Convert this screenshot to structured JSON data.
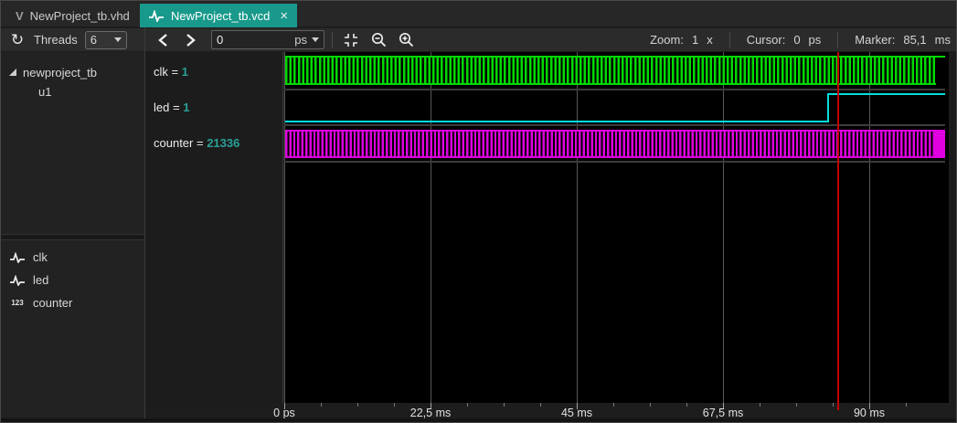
{
  "tabs": {
    "vhd": {
      "icon_letter": "V",
      "label": "NewProject_tb.vhd"
    },
    "vcd": {
      "label": "NewProject_tb.vcd",
      "close_glyph": "×"
    }
  },
  "sidebar": {
    "refresh_icon_glyph": "↻",
    "threads_label": "Threads",
    "threads_value": "6",
    "tree": {
      "root_label": "newproject_tb",
      "child_label": "u1"
    },
    "signal_list": [
      {
        "icon": "wave-icon",
        "label": "clk"
      },
      {
        "icon": "wave-icon",
        "label": "led"
      },
      {
        "icon": "number-icon",
        "icon_text": "123",
        "label": "counter"
      }
    ]
  },
  "toolbar": {
    "time_value": "0",
    "time_unit": "ps",
    "zoom_label": "Zoom:",
    "zoom_value": "1",
    "zoom_unit": "x",
    "cursor_label": "Cursor:",
    "cursor_value": "0",
    "cursor_unit": "ps",
    "marker_label": "Marker:",
    "marker_value": "85,1",
    "marker_unit": "ms"
  },
  "wave_panel": {
    "rows": [
      {
        "label": "clk =",
        "value": "1"
      },
      {
        "label": "led =",
        "value": "1"
      },
      {
        "label": "counter =",
        "value": "21336"
      }
    ]
  },
  "timeline": {
    "ticks": [
      "0 ps",
      "22,5 ms",
      "45 ms",
      "67,5 ms",
      "90 ms"
    ]
  },
  "colors": {
    "accent_teal": "#18998b",
    "clk_green": "#00d900",
    "led_cyan": "#00dede",
    "counter_magenta": "#dd00dd",
    "marker_red": "#c40000",
    "value_text_teal": "#2aa198"
  }
}
